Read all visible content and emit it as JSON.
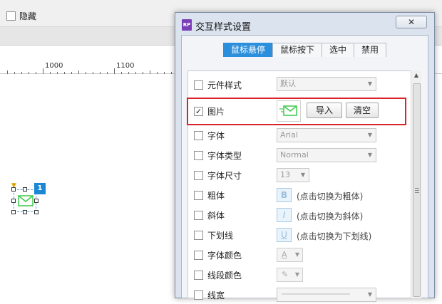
{
  "workspace": {
    "hide_label": "隐藏",
    "ruler_labels": [
      "1000",
      "1100"
    ],
    "widget_badge": "1"
  },
  "dialog": {
    "title": "交互样式设置",
    "logo": "RP",
    "close_label": "✕",
    "tabs": [
      {
        "label": "鼠标悬停",
        "active": true
      },
      {
        "label": "鼠标按下",
        "active": false
      },
      {
        "label": "选中",
        "active": false
      },
      {
        "label": "禁用",
        "active": false
      }
    ],
    "rows": {
      "widget_style": {
        "label": "元件样式",
        "value": "默认",
        "checked": false
      },
      "image": {
        "label": "图片",
        "checked": true,
        "import_label": "导入",
        "clear_label": "清空"
      },
      "font": {
        "label": "字体",
        "value": "Arial",
        "checked": false
      },
      "font_type": {
        "label": "字体类型",
        "value": "Normal",
        "checked": false
      },
      "font_size": {
        "label": "字体尺寸",
        "value": "13",
        "checked": false
      },
      "bold": {
        "label": "粗体",
        "button": "B",
        "hint": "(点击切换为粗体)",
        "checked": false
      },
      "italic": {
        "label": "斜体",
        "button": "I",
        "hint": "(点击切换为斜体)",
        "checked": false
      },
      "underline": {
        "label": "下划线",
        "button": "U",
        "hint": "(点击切换为下划线)",
        "checked": false
      },
      "font_color": {
        "label": "字体颜色",
        "checked": false
      },
      "line_color": {
        "label": "线段颜色",
        "checked": false
      },
      "line_width": {
        "label": "线宽",
        "checked": false
      }
    }
  },
  "colors": {
    "tab_active": "#2b8fdc",
    "highlight": "#d9232a",
    "envelope": "#3cc84a"
  }
}
